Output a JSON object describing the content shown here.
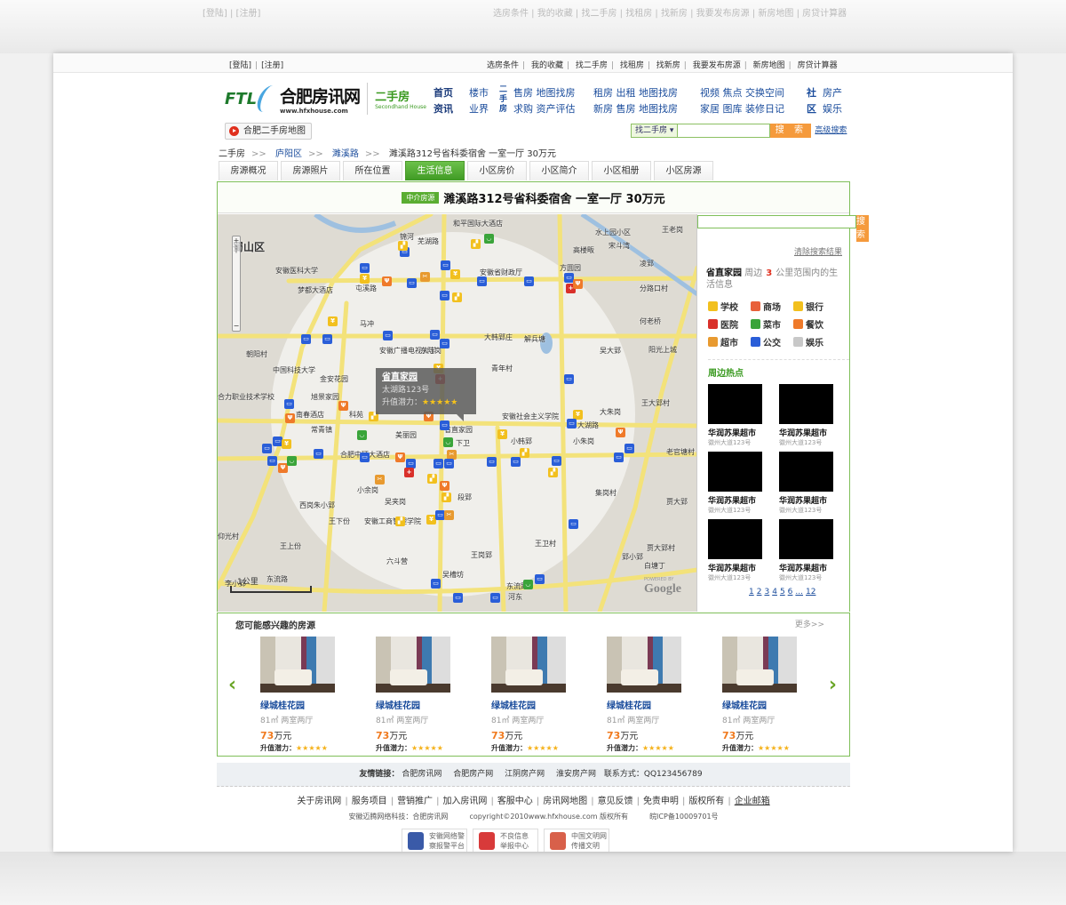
{
  "top": {
    "auth": [
      "[登陆]",
      "[注册]"
    ],
    "links": [
      "选房条件",
      "我的收藏",
      "找二手房",
      "找租房",
      "找新房",
      "我要发布房源",
      "新房地图",
      "房贷计算器"
    ]
  },
  "logo": {
    "mark": "FTL",
    "name": "合肥房讯网",
    "url": "www.hfxhouse.com",
    "section": "二手房",
    "section_en": "Secondhand House"
  },
  "nav": {
    "col1": [
      "首页",
      "资讯"
    ],
    "col2": [
      "楼市",
      "业界"
    ],
    "col3_head": "二手房",
    "col3": [
      "售房 地图找房",
      "求购 资产评估"
    ],
    "col4": [
      "租房 出租 地图找房",
      "新房 售房 地图找房"
    ],
    "col5": [
      "视频 焦点 交换空间",
      "家居 图库 装修日记"
    ],
    "col6": [
      "社区",
      "房产 娱乐"
    ]
  },
  "map_button": "合肥二手房地图",
  "search": {
    "category": "找二手房 ▾",
    "placeholder": "",
    "button": "搜 索",
    "advanced": "高级搜索"
  },
  "breadcrumb": [
    "二手房",
    "庐阳区",
    "濉溪路",
    "濉溪路312号省科委宿舍 一室一厅 30万元"
  ],
  "tabs": [
    "房源概况",
    "房源照片",
    "所在位置",
    "生活信息",
    "小区房价",
    "小区简介",
    "小区相册",
    "小区房源"
  ],
  "active_tab": "生活信息",
  "listing": {
    "badge": "中介房源",
    "title": "濉溪路312号省科委宿舍 一室一厅 30万元"
  },
  "map": {
    "labels": [
      "蜀山区",
      "安徽医科大学",
      "梦都大酒店",
      "屯溪路",
      "锦河",
      "芜湖路",
      "和平国际大酒店",
      "安徽省财政厅",
      "水上园小区",
      "高楼畈",
      "宋斗湾",
      "王老岗",
      "凌郢",
      "方圆园",
      "分路口村",
      "马冲",
      "大韩郢庄",
      "解兵塘",
      "何老桥",
      "吴大郢",
      "阳光上城",
      "朝阳村",
      "安徽广播电视大学",
      "东陆岗",
      "中国科技大学",
      "金安花园",
      "青年村",
      "旭景家园",
      "合力职业技术学校",
      "南春酒店",
      "科苑",
      "常青镇",
      "安徽社会主义学院",
      "大湖路",
      "大朱岗",
      "王大郢村",
      "美丽园",
      "省直家园",
      "下卫",
      "小韩郢",
      "小朱岗",
      "老官塘村",
      "合肥中环大酒店",
      "小余岗",
      "吴夹岗",
      "段郢",
      "西岗朱小郢",
      "集岗村",
      "贾大郢",
      "王下份",
      "安徽工商管理学院",
      "王卫村",
      "王上份",
      "贾大郢村",
      "王岗郢",
      "郢小郢",
      "白塘丁",
      "六斗营",
      "吴槽坊",
      "东流路",
      "东流路",
      "河东",
      "李小郢",
      "仰光村"
    ],
    "popup": {
      "name": "省直家园",
      "address": "太湖路123号",
      "rating_label": "升值潜力：",
      "rating": 5,
      "stars": "★★★★★"
    },
    "scale": "1公里",
    "attribution": "Google",
    "powered": "POWERED BY"
  },
  "sidebar": {
    "search_button": "搜 索",
    "clear": "清除搜索结果",
    "place": "省直家园",
    "info_pre": "周边",
    "radius": "3",
    "info_post": "公里范围内的生活信息",
    "categories": [
      {
        "label": "学校",
        "color": "#f2c01e"
      },
      {
        "label": "商场",
        "color": "#e8603a"
      },
      {
        "label": "银行",
        "color": "#f2c01e"
      },
      {
        "label": "医院",
        "color": "#d9302a"
      },
      {
        "label": "菜市",
        "color": "#3aa43a"
      },
      {
        "label": "餐饮",
        "color": "#ef7a2a"
      },
      {
        "label": "超市",
        "color": "#e89a30"
      },
      {
        "label": "公交",
        "color": "#2a5ed8"
      },
      {
        "label": "娱乐",
        "color": "#c8c8c8"
      }
    ],
    "hot_title": "周边热点",
    "hot": [
      {
        "name": "华润苏果超市",
        "addr": "徽州大道123号"
      },
      {
        "name": "华润苏果超市",
        "addr": "徽州大道123号"
      },
      {
        "name": "华润苏果超市",
        "addr": "徽州大道123号"
      },
      {
        "name": "华润苏果超市",
        "addr": "徽州大道123号"
      },
      {
        "name": "华润苏果超市",
        "addr": "徽州大道123号"
      },
      {
        "name": "华润苏果超市",
        "addr": "徽州大道123号"
      }
    ],
    "pages": [
      "1",
      "2",
      "3",
      "4",
      "5",
      "6",
      "...",
      "12"
    ]
  },
  "recommend": {
    "title": "您可能感兴趣的房源",
    "more": "更多>>",
    "prev": "‹",
    "next": "›",
    "items": [
      {
        "name": "绿城桂花园",
        "spec": "81㎡  两室两厅",
        "price": "73",
        "unit": "万元",
        "rating_label": "升值潜力：",
        "stars": "★★★★★"
      },
      {
        "name": "绿城桂花园",
        "spec": "81㎡  两室两厅",
        "price": "73",
        "unit": "万元",
        "rating_label": "升值潜力：",
        "stars": "★★★★★"
      },
      {
        "name": "绿城桂花园",
        "spec": "81㎡  两室两厅",
        "price": "73",
        "unit": "万元",
        "rating_label": "升值潜力：",
        "stars": "★★★★★"
      },
      {
        "name": "绿城桂花园",
        "spec": "81㎡  两室两厅",
        "price": "73",
        "unit": "万元",
        "rating_label": "升值潜力：",
        "stars": "★★★★★"
      },
      {
        "name": "绿城桂花园",
        "spec": "81㎡  两室两厅",
        "price": "73",
        "unit": "万元",
        "rating_label": "升值潜力：",
        "stars": "★★★★★"
      }
    ]
  },
  "friends": {
    "label": "友情链接：",
    "links": [
      "合肥房讯网",
      "合肥房产网",
      "江阴房产网",
      "淮安房产网"
    ],
    "contact": "联系方式：QQ123456789"
  },
  "footer": {
    "links": [
      "关于房讯网",
      "服务项目",
      "营销推广",
      "加入房讯网",
      "客服中心",
      "房讯网地图",
      "意见反馈",
      "免责申明",
      "版权所有",
      "企业邮箱"
    ],
    "company": "安徽迈腾网络科技：合肥房讯网",
    "copyright": "copyright©2010www.hfxhouse.com 版权所有",
    "icp": "皖ICP备10009701号",
    "badges": [
      {
        "line1": "安徽网络警",
        "line2": "察报警平台",
        "color": "#3a5aa8"
      },
      {
        "line1": "不良信息",
        "line2": "举报中心",
        "color": "#d83a3a"
      },
      {
        "line1": "中国文明网",
        "line2": "传播文明",
        "color": "#d8604a"
      }
    ]
  }
}
